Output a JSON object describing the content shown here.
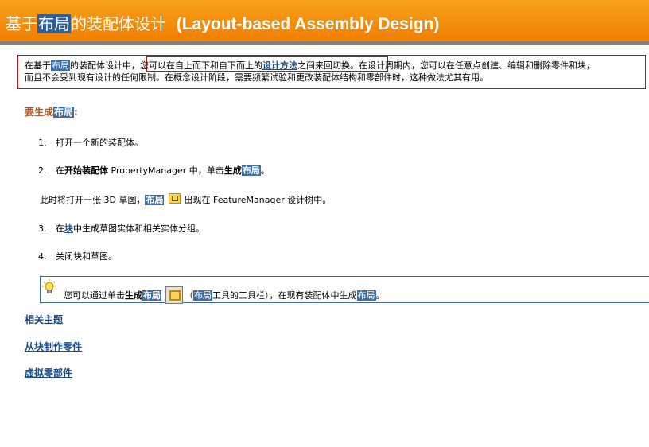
{
  "banner": {
    "title_pre": "基于",
    "title_hl": "布局",
    "title_post": "的装配体设计",
    "title_en": "(Layout-based Assembly Design)"
  },
  "intro": {
    "l1_a": "在基于",
    "l1_hl": "布局",
    "l1_b": "的装配体设计中，",
    "l1_c": "您可以在自上而下和自下而上的",
    "l1_link": "设计方法",
    "l1_d": "之间来回切换。",
    "l1_e": "在设计周期内，您可以在任意点创建、编辑和删除零件和块，",
    "l2": "而且不会受到现有设计的任何限制。在概念设计阶段，需要频繁试验和更改装配体结构和零部件时，这种做法尤其有用。"
  },
  "howto": {
    "heading_pre": "要生成",
    "heading_hl": "布局",
    "heading_colon": ":"
  },
  "steps": {
    "s1": {
      "num": "1.",
      "text": "打开一个新的装配体。"
    },
    "s2": {
      "num": "2.",
      "a": "在",
      "bold": "开始装配体",
      "b": " PropertyManager 中，单击",
      "bold2": "生成",
      "hl": "布局",
      "end": "。"
    },
    "note": {
      "a": "此时将打开一张 3D 草图，",
      "hl": "布局",
      "b": "出现在 FeatureManager 设计树中。"
    },
    "s3": {
      "num": "3.",
      "a": "在",
      "link": "块",
      "b": "中生成草图实体和相关实体分组。"
    },
    "s4": {
      "num": "4.",
      "text": "关闭块和草图。"
    }
  },
  "tip": {
    "a": "您可以通过单击",
    "bold": "生成",
    "hl": "布局",
    "b": "（",
    "hl2": "布局",
    "c": "工具的工具栏），在现有装配体中生成",
    "hl3": "布局",
    "d": "。"
  },
  "related": {
    "heading": "相关主题",
    "link1": "从块制作零件",
    "link2": "虚拟零部件"
  }
}
